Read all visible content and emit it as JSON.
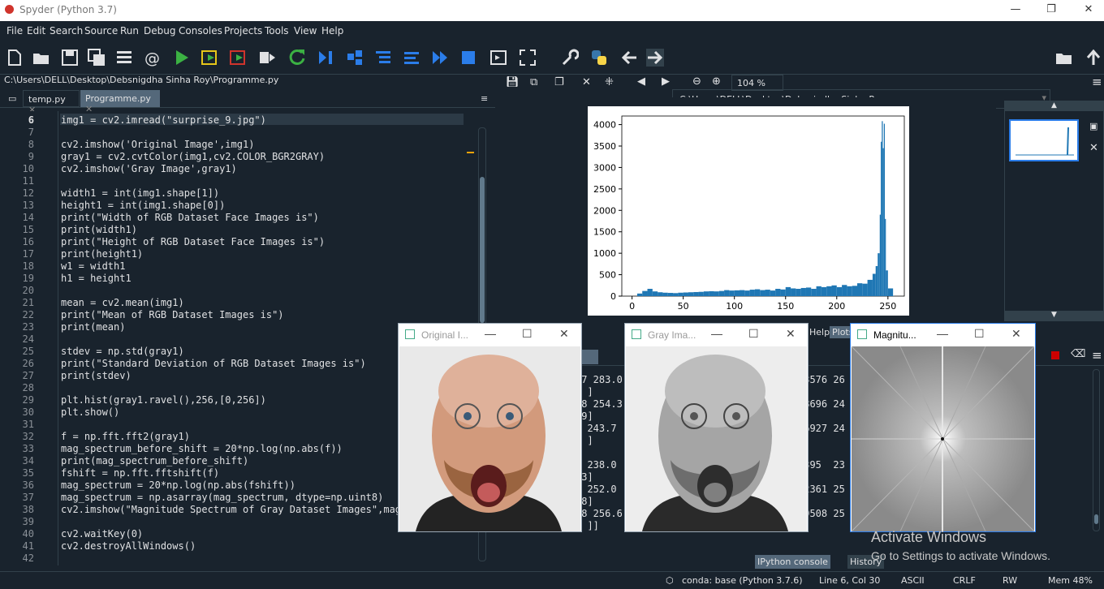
{
  "window": {
    "title": "Spyder (Python 3.7)",
    "minimize": "—",
    "restore": "❐",
    "close": "✕"
  },
  "menu": [
    "File",
    "Edit",
    "Search",
    "Source",
    "Run",
    "Debug",
    "Consoles",
    "Projects",
    "Tools",
    "View",
    "Help"
  ],
  "toolbar": {
    "path": "C:\\Users\\DELL\\Desktop\\Debsnigdha Sinha Roy"
  },
  "editor": {
    "filepath": "C:\\Users\\DELL\\Desktop\\Debsnigdha Sinha Roy\\Programme.py",
    "tabs": [
      {
        "label": "temp.py",
        "close": "✕"
      },
      {
        "label": "Programme.py",
        "close": "✕"
      }
    ],
    "lines": [
      {
        "n": "6",
        "code": "img1 = cv2.imread(\"surprise_9.jpg\")"
      },
      {
        "n": "7",
        "code": ""
      },
      {
        "n": "8",
        "code": "cv2.imshow('Original Image',img1)"
      },
      {
        "n": "9",
        "code": "gray1 = cv2.cvtColor(img1,cv2.COLOR_BGR2GRAY)"
      },
      {
        "n": "10",
        "code": "cv2.imshow('Gray Image',gray1)"
      },
      {
        "n": "11",
        "code": ""
      },
      {
        "n": "12",
        "code": "width1 = int(img1.shape[1])"
      },
      {
        "n": "13",
        "code": "height1 = int(img1.shape[0])"
      },
      {
        "n": "14",
        "code": "print(\"Width of RGB Dataset Face Images is\")"
      },
      {
        "n": "15",
        "code": "print(width1)"
      },
      {
        "n": "16",
        "code": "print(\"Height of RGB Dataset Face Images is\")"
      },
      {
        "n": "17",
        "code": "print(height1)"
      },
      {
        "n": "18",
        "code": "w1 = width1"
      },
      {
        "n": "19",
        "code": "h1 = height1"
      },
      {
        "n": "20",
        "code": ""
      },
      {
        "n": "21",
        "code": "mean = cv2.mean(img1)"
      },
      {
        "n": "22",
        "code": "print(\"Mean of RGB Dataset Images is\")"
      },
      {
        "n": "23",
        "code": "print(mean)"
      },
      {
        "n": "24",
        "code": ""
      },
      {
        "n": "25",
        "code": "stdev = np.std(gray1)"
      },
      {
        "n": "26",
        "code": "print(\"Standard Deviation of RGB Dataset Images is\")"
      },
      {
        "n": "27",
        "code": "print(stdev)"
      },
      {
        "n": "28",
        "code": ""
      },
      {
        "n": "29",
        "code": "plt.hist(gray1.ravel(),256,[0,256])"
      },
      {
        "n": "30",
        "code": "plt.show()"
      },
      {
        "n": "31",
        "code": ""
      },
      {
        "n": "32",
        "code": "f = np.fft.fft2(gray1)"
      },
      {
        "n": "33",
        "code": "mag_spectrum_before_shift = 20*np.log(np.abs(f))"
      },
      {
        "n": "34",
        "code": "print(mag_spectrum_before_shift)"
      },
      {
        "n": "35",
        "code": "fshift = np.fft.fftshift(f)"
      },
      {
        "n": "36",
        "code": "mag_spectrum = 20*np.log(np.abs(fshift))"
      },
      {
        "n": "37",
        "code": "mag_spectrum = np.asarray(mag_spectrum, dtype=np.uint8)"
      },
      {
        "n": "38",
        "code": "cv2.imshow(\"Magnitude Spectrum of Gray Dataset Images\",mag_"
      },
      {
        "n": "39",
        "code": ""
      },
      {
        "n": "40",
        "code": "cv2.waitKey(0)"
      },
      {
        "n": "41",
        "code": "cv2.destroyAllWindows()"
      },
      {
        "n": "42",
        "code": ""
      }
    ]
  },
  "plots": {
    "zoom": "104 %"
  },
  "chart_data": {
    "type": "bar",
    "title": "",
    "xlabel": "",
    "ylabel": "",
    "xlim": [
      -10,
      266
    ],
    "ylim": [
      0,
      4200
    ],
    "xticks": [
      "0",
      "50",
      "100",
      "150",
      "200",
      "250"
    ],
    "yticks": [
      "0",
      "500",
      "1000",
      "1500",
      "2000",
      "2500",
      "3000",
      "3500",
      "4000"
    ],
    "color": "#1f77b4",
    "x": [
      0,
      5,
      10,
      15,
      20,
      25,
      30,
      35,
      40,
      45,
      50,
      55,
      60,
      65,
      70,
      75,
      80,
      85,
      90,
      95,
      100,
      105,
      110,
      115,
      120,
      125,
      130,
      135,
      140,
      145,
      150,
      155,
      160,
      165,
      170,
      175,
      180,
      185,
      190,
      195,
      200,
      205,
      210,
      215,
      220,
      225,
      230,
      235,
      238,
      240,
      242,
      243,
      244,
      245,
      246,
      247,
      248,
      250,
      255
    ],
    "values": [
      0,
      60,
      120,
      170,
      110,
      90,
      80,
      75,
      70,
      80,
      85,
      90,
      95,
      100,
      110,
      115,
      110,
      120,
      140,
      130,
      135,
      140,
      130,
      150,
      160,
      140,
      150,
      130,
      170,
      155,
      210,
      180,
      170,
      190,
      200,
      170,
      230,
      210,
      230,
      250,
      210,
      260,
      230,
      240,
      300,
      290,
      380,
      520,
      700,
      1000,
      1900,
      3600,
      4080,
      3450,
      4020,
      1800,
      600,
      180,
      10
    ]
  },
  "panes": {
    "help_tab": "Help",
    "plots_tab": "Plots",
    "ipython_tab": "IPython console",
    "history_tab": "History"
  },
  "console": {
    "lines": [
      "77 283.0",
      "8 ]",
      "08 254.3",
      "89]",
      "4 243.7",
      "4 ]",
      "",
      "9 238.0",
      "23]",
      "4 252.0",
      "98]",
      "98 256.6",
      "0 ]]"
    ],
    "right": [
      "43576 26",
      "",
      "48696 24",
      "",
      "46927 24",
      "",
      "",
      "0395  23",
      "",
      "22361 25",
      "",
      "19508 25",
      ""
    ]
  },
  "cv_windows": [
    {
      "title": "Original I...",
      "buttons": [
        "—",
        "☐",
        "✕"
      ]
    },
    {
      "title": "Gray Ima...",
      "buttons": [
        "—",
        "☐",
        "✕"
      ]
    },
    {
      "title": "Magnitu...",
      "buttons": [
        "—",
        "☐",
        "✕"
      ]
    }
  ],
  "watermark": {
    "line1": "Activate Windows",
    "line2": "Go to Settings to activate Windows."
  },
  "status": {
    "env": "conda: base (Python 3.7.6)",
    "cursor": "Line 6, Col 30",
    "encoding": "ASCII",
    "eol": "CRLF",
    "perm": "RW",
    "mem": "Mem 48%"
  }
}
